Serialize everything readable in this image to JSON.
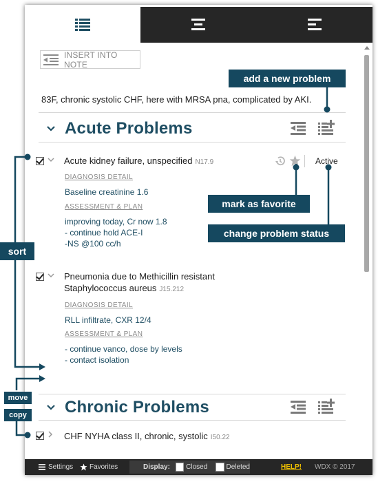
{
  "insert_button": {
    "label": "INSERT INTO NOTE"
  },
  "summary": "83F, chronic systolic CHF, here with MRSA pna, complicated by AKI.",
  "sections": {
    "acute": {
      "title": "Acute Problems",
      "problems": [
        {
          "title": "Acute kidney failure, unspecified",
          "code": "N17.9",
          "status": "Active",
          "diagnosis_label": "DIAGNOSIS DETAIL",
          "diagnosis": "Baseline creatinine 1.6",
          "assessment_label": "ASSESSMENT & PLAN",
          "assessment": [
            "improving today, Cr now 1.8",
            "- continue hold ACE-I",
            "-NS @100 cc/h"
          ]
        },
        {
          "title_line1": "Pneumonia due to Methicillin resistant",
          "title_line2": "Staphylococcus aureus",
          "code": "J15.212",
          "diagnosis_label": "DIAGNOSIS DETAIL",
          "diagnosis": "RLL infiltrate, CXR 12/4",
          "assessment_label": "ASSESSMENT & PLAN",
          "assessment": [
            "- continue vanco, dose by levels",
            "- contact isolation"
          ]
        }
      ]
    },
    "chronic": {
      "title": "Chronic Problems",
      "problems": [
        {
          "title": "CHF NYHA class II, chronic, systolic",
          "code": "I50.22"
        }
      ]
    }
  },
  "callouts": {
    "add_problem": "add a new problem",
    "favorite": "mark as favorite",
    "status": "change problem status",
    "sort": "sort",
    "move": "move",
    "copy": "copy"
  },
  "footer": {
    "settings": "Settings",
    "favorites": "Favorites",
    "display_label": "Display:",
    "closed": "Closed",
    "deleted": "Deleted",
    "help": "HELP!",
    "copyright": "WDX © 2017"
  },
  "colors": {
    "accent": "#15485f",
    "title": "#1f4e63",
    "dark_bar": "#262626",
    "help": "#f3c300"
  },
  "icons": [
    "list-icon",
    "center-align-icon",
    "left-align-icon",
    "insert-note-icon",
    "sort-icon",
    "add-problem-icon",
    "history-icon",
    "star-icon",
    "chevron-down-icon",
    "chevron-right-icon"
  ]
}
